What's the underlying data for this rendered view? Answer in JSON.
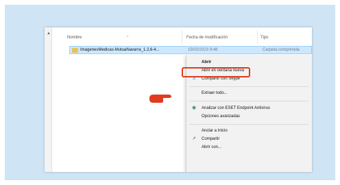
{
  "columns": {
    "name": "Nombre",
    "date_modified": "Fecha de modificación",
    "type": "Tipo"
  },
  "file": {
    "name": "ImagenesMedicas-MutuaNavarra_1.2,6-4...",
    "date": "15/02/2023 9:48",
    "type": "Carpeta comprimida"
  },
  "context_menu": {
    "items": [
      {
        "label": "Abrir"
      },
      {
        "label": "Abrir en ventana nueva"
      },
      {
        "label": "Compartir con Skype"
      },
      {
        "label": "Extraer todo..."
      },
      {
        "label": "Analizar con ESET Endpoint Antivirus"
      },
      {
        "label": "Opciones avanzadas"
      },
      {
        "label": "Anclar a Inicio"
      },
      {
        "label": "Compartir"
      },
      {
        "label": "Abrir con..."
      }
    ]
  },
  "colors": {
    "frame_background": "#cfe4f4",
    "highlight": "#e23a1f",
    "selection": "#cce8ff"
  },
  "icons": [
    "collapse-arrow-icon",
    "folder-zip-icon",
    "skype-icon",
    "eset-icon",
    "share-icon",
    "pointing-hand-icon"
  ]
}
